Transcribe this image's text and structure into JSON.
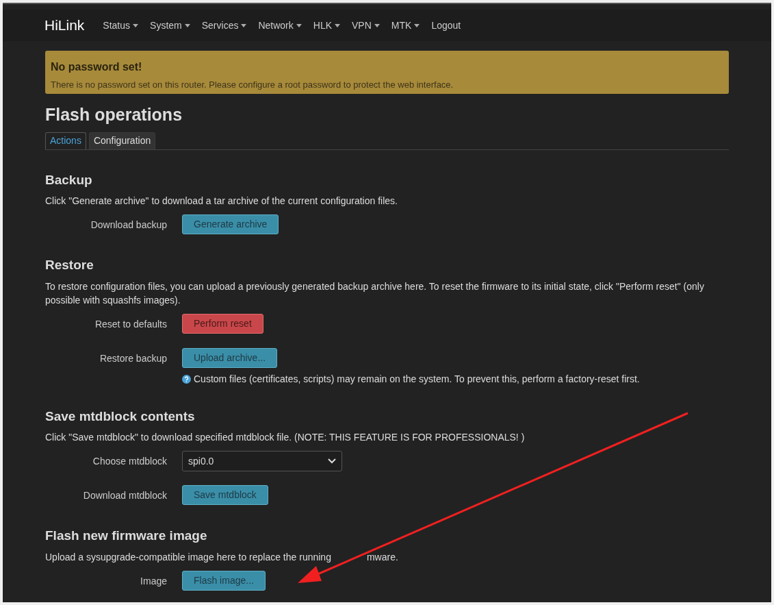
{
  "navbar": {
    "brand": "HiLink",
    "menu": [
      {
        "label": "Status",
        "dropdown": true
      },
      {
        "label": "System",
        "dropdown": true
      },
      {
        "label": "Services",
        "dropdown": true
      },
      {
        "label": "Network",
        "dropdown": true
      },
      {
        "label": "HLK",
        "dropdown": true
      },
      {
        "label": "VPN",
        "dropdown": true
      },
      {
        "label": "MTK",
        "dropdown": true
      },
      {
        "label": "Logout",
        "dropdown": false
      }
    ]
  },
  "alert": {
    "title": "No password set!",
    "message": "There is no password set on this router. Please configure a root password to protect the web interface."
  },
  "page_title": "Flash operations",
  "tabs": [
    {
      "label": "Actions",
      "selected": true
    },
    {
      "label": "Configuration",
      "selected": false
    }
  ],
  "sections": [
    {
      "title": "Backup",
      "description": "Click \"Generate archive\" to download a tar archive of the current configuration files.",
      "rows": [
        {
          "label": "Download backup",
          "kind": "primary",
          "text": "Generate archive"
        }
      ]
    },
    {
      "title": "Restore",
      "description": "To restore configuration files, you can upload a previously generated backup archive here. To reset the firmware to its initial state, click \"Perform reset\" (only possible with squashfs images).",
      "rows": [
        {
          "label": "Reset to defaults",
          "kind": "danger",
          "text": "Perform reset"
        },
        {
          "label": "Restore backup",
          "kind": "primary",
          "text": "Upload archive...",
          "hint": "Custom files (certificates, scripts) may remain on the system. To prevent this, perform a factory-reset first."
        }
      ]
    },
    {
      "title": "Save mtdblock contents",
      "description": "Click \"Save mtdblock\" to download specified mtdblock file. (NOTE: THIS FEATURE IS FOR PROFESSIONALS! )",
      "rows": [
        {
          "label": "Choose mtdblock",
          "kind": "select",
          "text": "spi0.0"
        },
        {
          "label": "Download mtdblock",
          "kind": "primary",
          "text": "Save mtdblock"
        }
      ]
    },
    {
      "title": "Flash new firmware image",
      "description": "Upload a sysupgrade-compatible image here to replace the running",
      "description_tail": "mware.",
      "rows": [
        {
          "label": "Image",
          "kind": "primary",
          "text": "Flash image..."
        }
      ]
    }
  ]
}
